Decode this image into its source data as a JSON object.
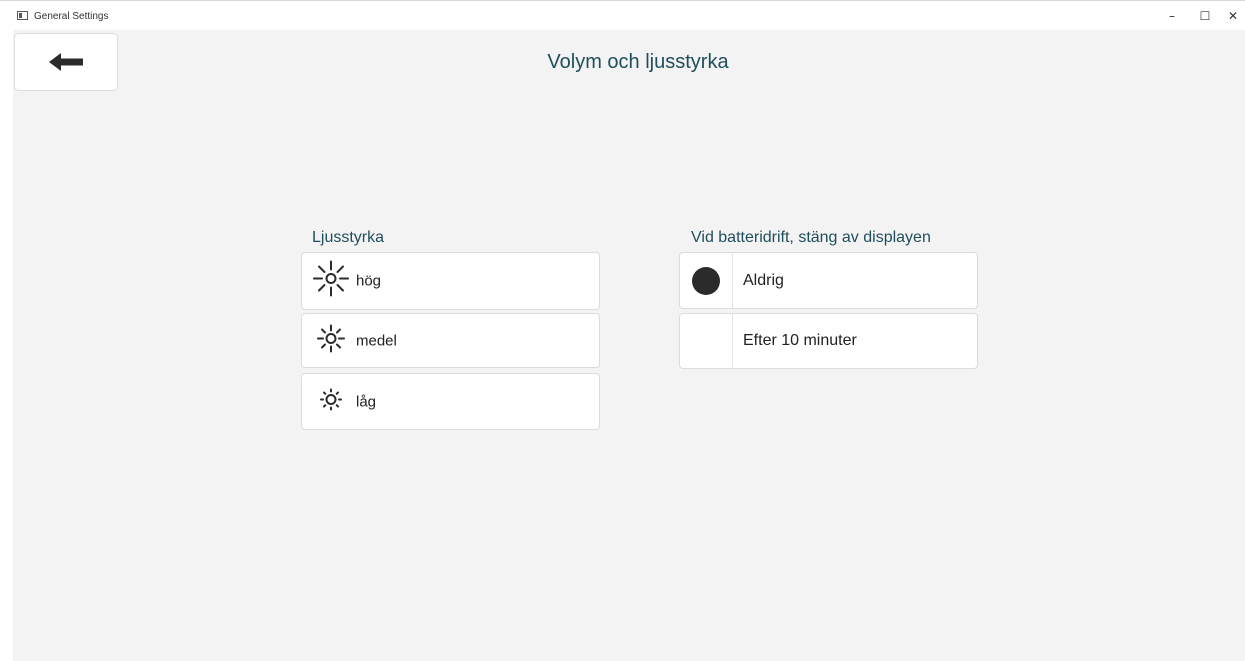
{
  "window": {
    "title": "General Settings",
    "minimize_glyph": "–",
    "maximize_glyph": "☐",
    "close_glyph": "✕"
  },
  "header": {
    "back_icon": "arrow-left-icon",
    "title": "Volym och ljusstyrka"
  },
  "brightness": {
    "heading": "Ljusstyrka",
    "options": [
      {
        "label": "hög",
        "icon": "sun-large-icon"
      },
      {
        "label": "medel",
        "icon": "sun-medium-icon"
      },
      {
        "label": "låg",
        "icon": "sun-small-icon"
      }
    ]
  },
  "battery": {
    "heading": "Vid batteridrift, stäng av displayen",
    "options": [
      {
        "label": "Aldrig",
        "selected": true
      },
      {
        "label": "Efter 10 minuter",
        "selected": false
      }
    ]
  },
  "colors": {
    "accent_text": "#1f4e5c",
    "background": "#f3f3f3",
    "card": "#ffffff",
    "selected_dot": "#2b2b2b"
  }
}
